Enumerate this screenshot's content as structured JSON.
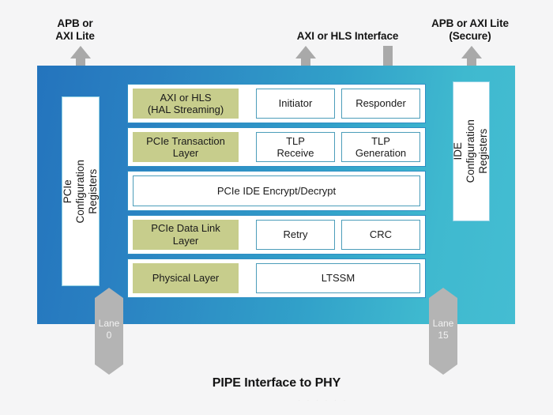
{
  "diagram": {
    "footer_label": "PIPE Interface to PHY",
    "ellipsis": "· · · · · ·"
  },
  "captions": [
    {
      "id": "apb-axi-lite",
      "text": "APB or\nAXI Lite"
    },
    {
      "id": "axi-hls-interface",
      "text": "AXI or HLS Interface"
    },
    {
      "id": "apb-axi-lite-secure",
      "text": "APB or AXI Lite\n(Secure)"
    }
  ],
  "side_boxes": {
    "left": {
      "label": "PCIe Configuration Registers"
    },
    "right": {
      "label": "IDE Configuration\nRegisters"
    }
  },
  "stack": {
    "rows": [
      {
        "id": "axi-hls",
        "layer": "AXI or HLS\n(HAL Streaming)",
        "blocks": [
          {
            "id": "initiator",
            "label": "Initiator"
          },
          {
            "id": "responder",
            "label": "Responder"
          }
        ]
      },
      {
        "id": "pcie-transaction-layer",
        "layer": "PCIe Transaction\nLayer",
        "blocks": [
          {
            "id": "tlp-receive",
            "label": "TLP\nReceive"
          },
          {
            "id": "tlp-generation",
            "label": "TLP\nGeneration"
          }
        ]
      },
      {
        "id": "pcie-ide",
        "layer": "",
        "blocks": [
          {
            "id": "pcie-ide-encrypt-decrypt",
            "label": "PCIe IDE Encrypt/Decrypt"
          }
        ]
      },
      {
        "id": "pcie-data-link-layer",
        "layer": "PCIe Data Link\nLayer",
        "blocks": [
          {
            "id": "retry",
            "label": "Retry"
          },
          {
            "id": "crc",
            "label": "CRC"
          }
        ]
      },
      {
        "id": "physical-layer",
        "layer": "Physical Layer",
        "blocks": [
          {
            "id": "ltssm",
            "label": "LTSSM"
          }
        ]
      }
    ]
  },
  "lanes": [
    {
      "id": "lane-0",
      "label": "Lane\n0"
    },
    {
      "id": "lane-15",
      "label": "Lane\n15"
    }
  ],
  "colors": {
    "panel_left": "#2474bd",
    "panel_right": "#44bdd2",
    "layer_green": "#c7cd8c",
    "block_border": "#4c9dba",
    "row_border": "#2f8fc4",
    "arrow_gray": "#a9a9a9",
    "lane_gray": "#b4b4b4"
  }
}
